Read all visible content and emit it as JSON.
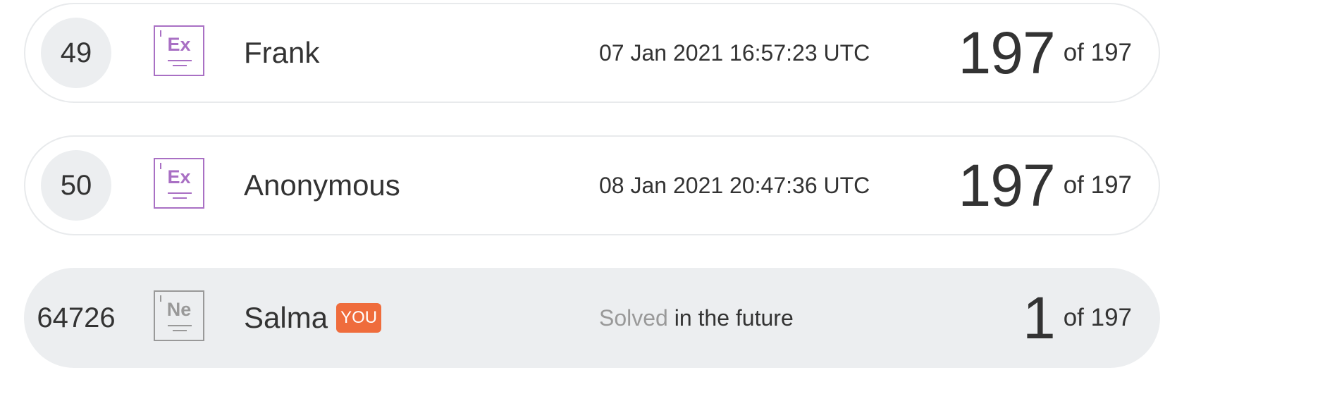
{
  "rows": [
    {
      "rank": "49",
      "element_badge": "Ex",
      "name": "Frank",
      "solved_date": "07 Jan 2021 16:57:23 UTC",
      "score": "197",
      "of_total": "of 197"
    },
    {
      "rank": "50",
      "element_badge": "Ex",
      "name": "Anonymous",
      "solved_date": "08 Jan 2021 20:47:36 UTC",
      "score": "197",
      "of_total": "of 197"
    },
    {
      "rank": "64726",
      "element_badge": "Ne",
      "name": "Salma",
      "you_label": "YOU",
      "solved_prefix": "Solved",
      "solved_suffix": "in the future",
      "score": "1",
      "of_total": "of 197"
    }
  ],
  "colors": {
    "badge_purple": "#a970c4",
    "badge_gray": "#999999",
    "you_badge": "#ef6c3c",
    "current_user_row": "#eceef0"
  },
  "icons": {
    "expert_badge": "element-tile-icon",
    "newbie_badge": "element-tile-icon"
  }
}
